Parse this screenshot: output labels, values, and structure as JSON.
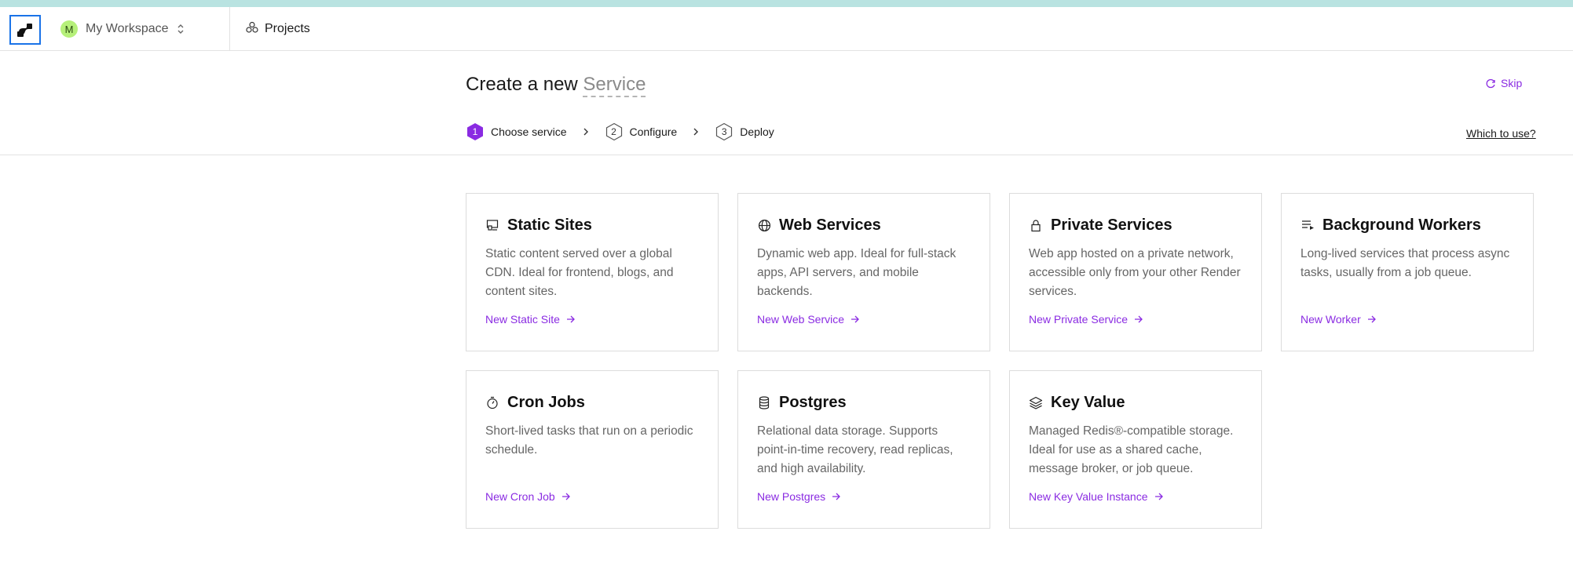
{
  "topbar": {
    "workspace_initial": "M",
    "workspace_name": "My Workspace",
    "projects_label": "Projects"
  },
  "header": {
    "title_prefix": "Create a new",
    "title_word": "Service",
    "skip_label": "Skip",
    "which_label": "Which to use?"
  },
  "steps": [
    {
      "num": "1",
      "label": "Choose service",
      "active": true
    },
    {
      "num": "2",
      "label": "Configure",
      "active": false
    },
    {
      "num": "3",
      "label": "Deploy",
      "active": false
    }
  ],
  "cards": [
    {
      "icon": "static-site-icon",
      "title": "Static Sites",
      "desc": "Static content served over a global CDN. Ideal for frontend, blogs, and content sites.",
      "link": "New Static Site"
    },
    {
      "icon": "globe-icon",
      "title": "Web Services",
      "desc": "Dynamic web app. Ideal for full-stack apps, API servers, and mobile backends.",
      "link": "New Web Service"
    },
    {
      "icon": "lock-icon",
      "title": "Private Services",
      "desc": "Web app hosted on a private network, accessible only from your other Render services.",
      "link": "New Private Service"
    },
    {
      "icon": "list-play-icon",
      "title": "Background Workers",
      "desc": "Long-lived services that process async tasks, usually from a job queue.",
      "link": "New Worker"
    },
    {
      "icon": "stopwatch-icon",
      "title": "Cron Jobs",
      "desc": "Short-lived tasks that run on a periodic schedule.",
      "link": "New Cron Job"
    },
    {
      "icon": "database-icon",
      "title": "Postgres",
      "desc": "Relational data storage. Supports point-in-time recovery, read replicas, and high availability.",
      "link": "New Postgres"
    },
    {
      "icon": "layers-icon",
      "title": "Key Value",
      "desc": "Managed Redis®-compatible storage. Ideal for use as a shared cache, message broker, or job queue.",
      "link": "New Key Value Instance"
    }
  ],
  "colors": {
    "accent": "#8a2be2",
    "top_strip": "#b9e3e1",
    "avatar_bg": "#b6f07a",
    "focus_outline": "#1a73e8"
  }
}
